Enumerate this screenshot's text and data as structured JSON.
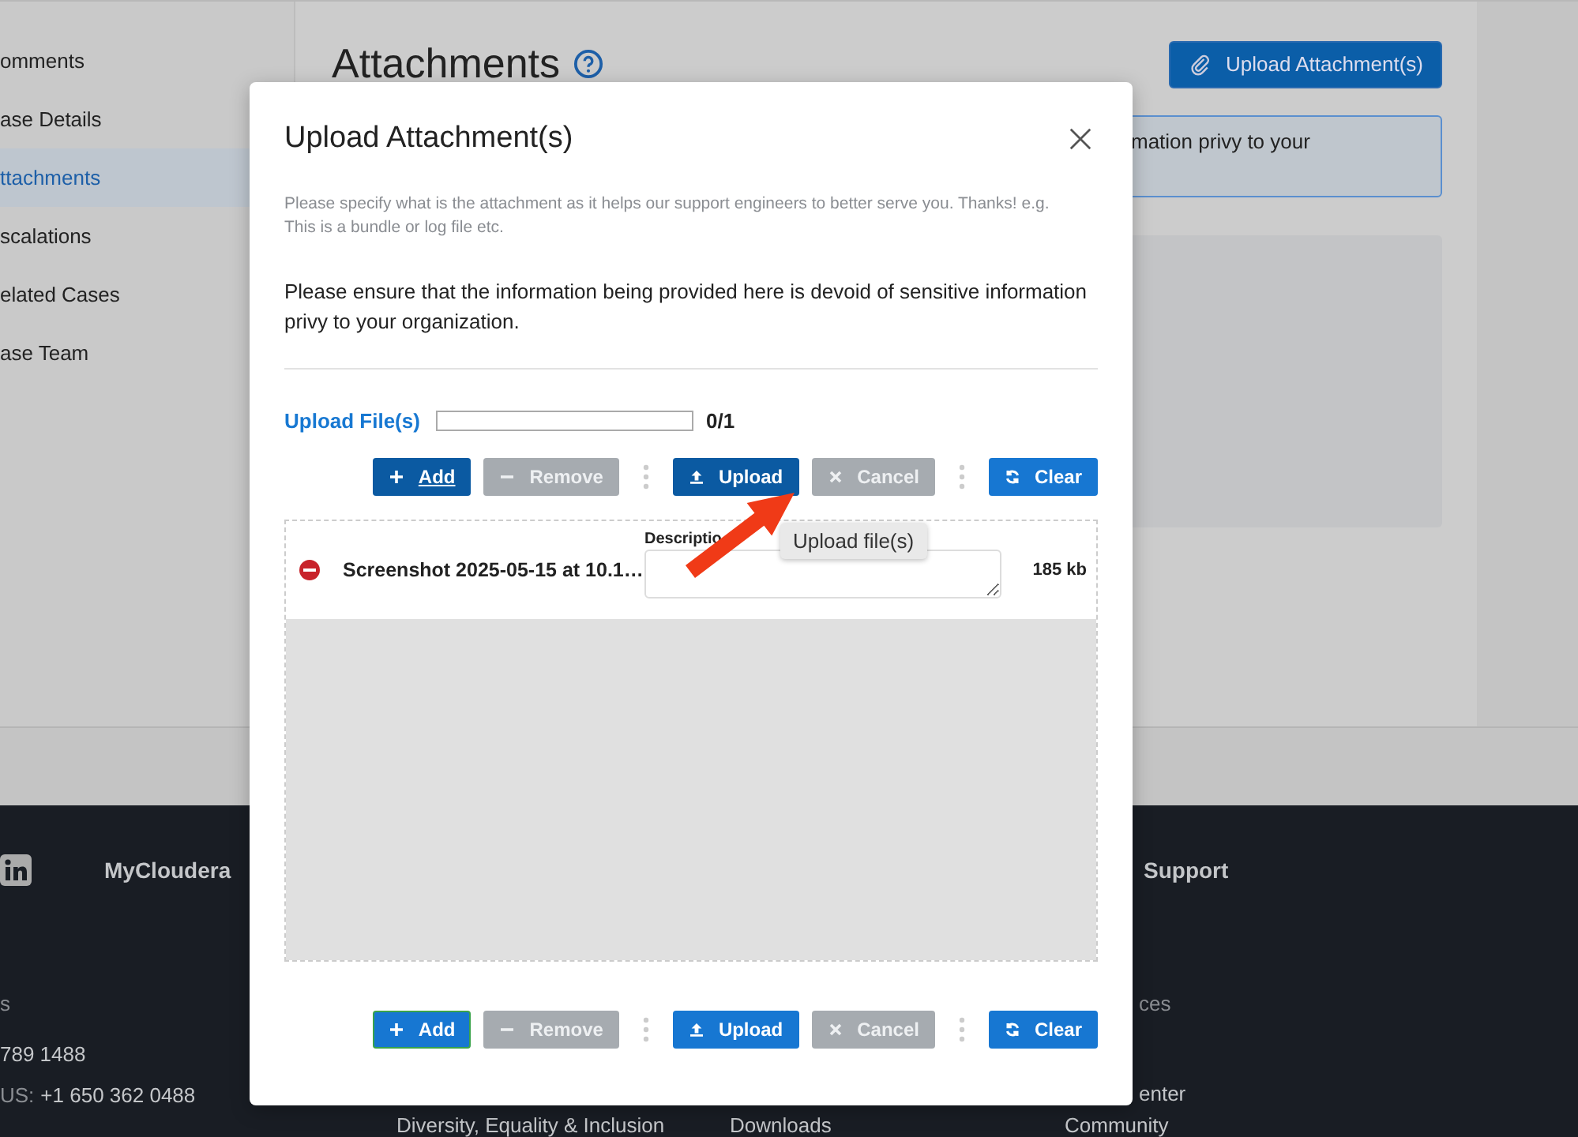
{
  "sidebar": {
    "items": [
      {
        "label": "omments",
        "selected": false
      },
      {
        "label": "ase Details",
        "selected": false
      },
      {
        "label": "ttachments",
        "selected": true
      },
      {
        "label": "scalations",
        "selected": false
      },
      {
        "label": "elated Cases",
        "selected": false
      },
      {
        "label": "ase Team",
        "selected": false
      }
    ]
  },
  "page": {
    "title": "Attachments",
    "upload_button": "Upload Attachment(s)",
    "notice": "mation privy to your"
  },
  "footer": {
    "heading": "MyCloudera",
    "support_heading": "Support",
    "contact_label": "s",
    "phones": [
      {
        "number": "789 1488"
      },
      {
        "label": "US:",
        "number": "+1 650 362 0488"
      }
    ],
    "resources_label": "ces",
    "resources_link": "enter",
    "bottom_links": [
      "Diversity, Equality & Inclusion",
      "Downloads",
      "Community"
    ]
  },
  "dialog": {
    "title": "Upload Attachment(s)",
    "hint": "Please specify what is the attachment as it helps our support engineers to better serve you. Thanks! e.g. This is a bundle or log file etc.",
    "notice": "Please ensure that the information being provided here is devoid of sensitive information privy to your organization.",
    "upload_label": "Upload File(s)",
    "progress": {
      "level": 0,
      "count": "0/1"
    },
    "toolbars": [
      {
        "buttons": [
          {
            "kind": "add",
            "label": "Add",
            "disabled": false,
            "hovered": true,
            "focused": false
          },
          {
            "kind": "remove",
            "label": "Remove",
            "disabled": true,
            "hovered": false,
            "focused": false
          },
          {
            "kind": "separator"
          },
          {
            "kind": "upload",
            "label": "Upload",
            "disabled": false,
            "hovered": true,
            "focused": false
          },
          {
            "kind": "cancel",
            "label": "Cancel",
            "disabled": true,
            "hovered": false,
            "focused": false
          },
          {
            "kind": "separator"
          },
          {
            "kind": "clear",
            "label": "Clear",
            "disabled": false,
            "hovered": false,
            "focused": false
          }
        ]
      },
      {
        "buttons": [
          {
            "kind": "add",
            "label": "Add",
            "disabled": false,
            "hovered": false,
            "focused": true
          },
          {
            "kind": "remove",
            "label": "Remove",
            "disabled": true,
            "hovered": false,
            "focused": false
          },
          {
            "kind": "separator"
          },
          {
            "kind": "upload",
            "label": "Upload",
            "disabled": false,
            "hovered": false,
            "focused": false
          },
          {
            "kind": "cancel",
            "label": "Cancel",
            "disabled": true,
            "hovered": false,
            "focused": false
          },
          {
            "kind": "separator"
          },
          {
            "kind": "clear",
            "label": "Clear",
            "disabled": false,
            "hovered": false,
            "focused": false
          }
        ]
      }
    ],
    "files": [
      {
        "name": "Screenshot 2025-05-15 at 10.1…",
        "description_label": "Descriptio",
        "size": "185 kb"
      }
    ],
    "tooltip": "Upload file(s)"
  }
}
